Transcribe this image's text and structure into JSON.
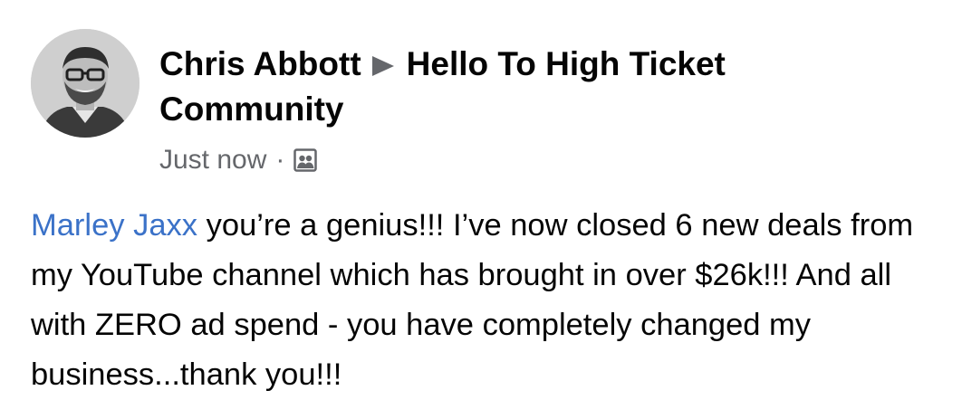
{
  "post": {
    "author_name": "Chris Abbott",
    "group_name_line1": "Hello To High Ticket",
    "group_name_line2": "Community",
    "timestamp": "Just now",
    "separator": "·",
    "audience_icon": "group-audience-icon",
    "mention": "Marley Jaxx",
    "body_text": " you’re a genius!!! I’ve now closed 6 new deals from my YouTube channel which has brought in over $26k!!! And all with ZERO ad spend - you have completely changed my business...thank you!!!"
  },
  "colors": {
    "author_text": "#050505",
    "meta_text": "#65676b",
    "mention_link": "#3b72c8"
  }
}
